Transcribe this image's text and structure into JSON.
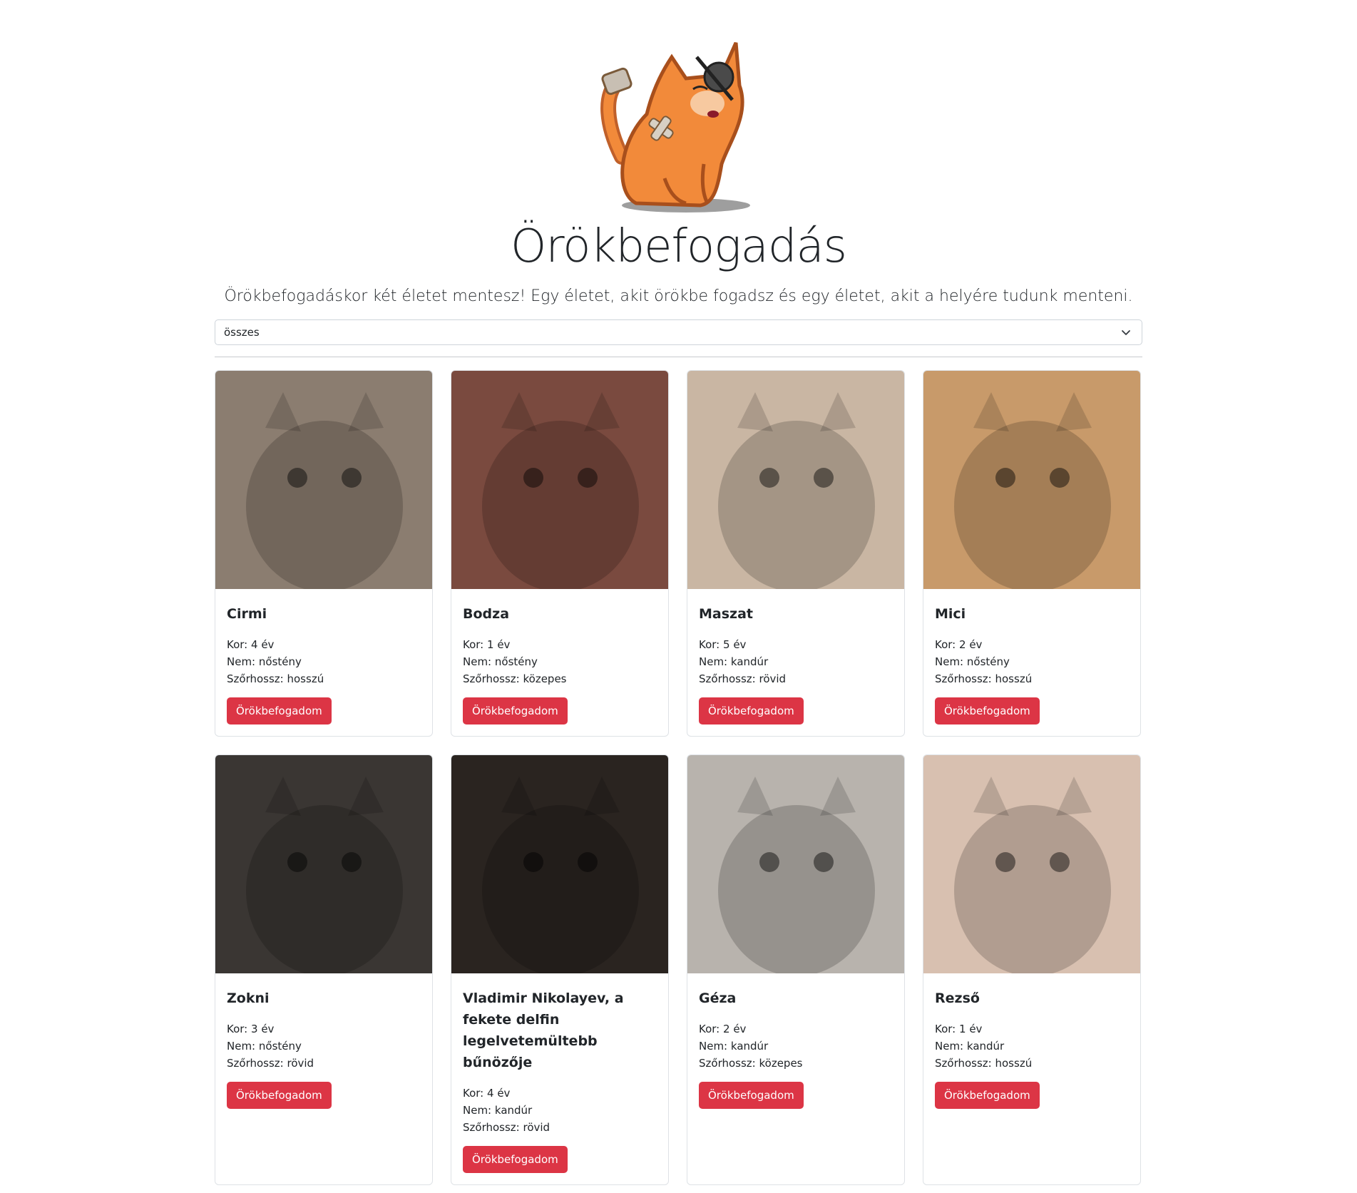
{
  "header": {
    "title": "Örökbefogadás",
    "lead": "Örökbefogadáskor két életet mentesz! Egy életet, akit örökbe fogadsz és egy életet, akit a helyére tudunk menteni."
  },
  "filter": {
    "selected": "összes"
  },
  "labels": {
    "age": "Kor:",
    "sex": "Nem:",
    "fur": "Szőrhossz:",
    "adopt_button": "Örökbefogadom"
  },
  "cats": [
    {
      "name": "Cirmi",
      "age": "4 év",
      "sex": "nőstény",
      "fur": "hosszú",
      "photo_color": "#8b7d70"
    },
    {
      "name": "Bodza",
      "age": "1 év",
      "sex": "nőstény",
      "fur": "közepes",
      "photo_color": "#7a4a3f"
    },
    {
      "name": "Maszat",
      "age": "5 év",
      "sex": "kandúr",
      "fur": "rövid",
      "photo_color": "#c9b6a3"
    },
    {
      "name": "Mici",
      "age": "2 év",
      "sex": "nőstény",
      "fur": "hosszú",
      "photo_color": "#c89a6a"
    },
    {
      "name": "Zokni",
      "age": "3 év",
      "sex": "nőstény",
      "fur": "rövid",
      "photo_color": "#3a3633"
    },
    {
      "name": "Vladimir Nikolayev, a fekete delfin legelvetemültebb bűnözője",
      "age": "4 év",
      "sex": "kandúr",
      "fur": "rövid",
      "photo_color": "#2a2420"
    },
    {
      "name": "Géza",
      "age": "2 év",
      "sex": "kandúr",
      "fur": "közepes",
      "photo_color": "#b8b3ad"
    },
    {
      "name": "Rezső",
      "age": "1 év",
      "sex": "kandúr",
      "fur": "hosszú",
      "photo_color": "#d8c0b0"
    }
  ],
  "colors": {
    "button": "#dc3545",
    "border": "#dee2e6",
    "text": "#212529"
  }
}
